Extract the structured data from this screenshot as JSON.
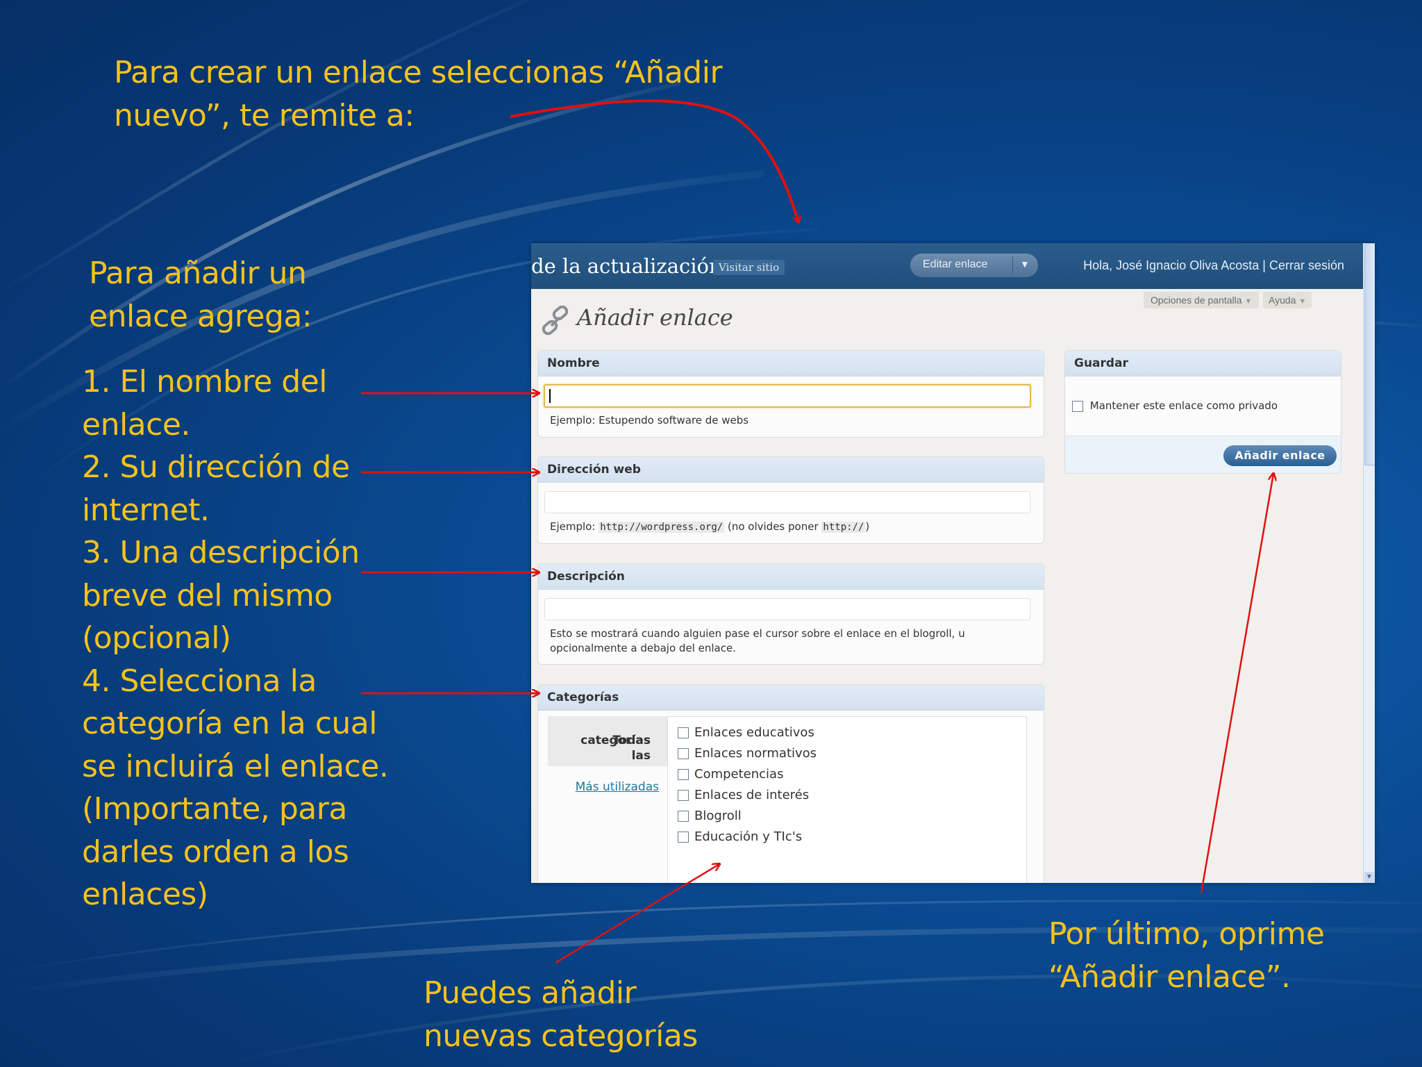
{
  "annotations": {
    "intro": [
      "Para crear un enlace seleccionas “Añadir",
      "nuevo”,  te remite a:"
    ],
    "add_heading": [
      "Para añadir un",
      "enlace agrega:"
    ],
    "steps": [
      "1. El nombre del",
      "enlace.",
      "2. Su dirección de",
      "internet.",
      "3. Una descripción",
      "breve del mismo",
      "(opcional)",
      "4. Selecciona la",
      "categoría en la cual",
      "se incluirá el enlace.",
      "(Importante, para",
      "darles orden a los",
      "enlaces)"
    ],
    "new_categories": [
      "Puedes añadir",
      "nuevas categorías"
    ],
    "finally": [
      "Por último, oprime",
      "“Añadir enlace”."
    ]
  },
  "colors": {
    "annotation_text": "#f6c21c",
    "arrow": "#e01010",
    "topbar": "#21527f",
    "accent_focus": "#e5b74a"
  },
  "screenshot": {
    "header": {
      "site_title": "de la actualización",
      "visit_label": "Visitar sitio",
      "edit_button": "Editar enlace",
      "dropdown_icon": "triangle-down",
      "greeting": "Hola, José Ignacio Oliva Acosta | Cerrar sesión"
    },
    "screen_options": "Opciones de pantalla",
    "help": "Ayuda",
    "page_title": "Añadir enlace",
    "page_icon": "link-chain",
    "name_box": {
      "title": "Nombre",
      "value": "",
      "hint": "Ejemplo: Estupendo software de webs"
    },
    "url_box": {
      "title": "Dirección web",
      "value": "",
      "hint_prefix": "Ejemplo:",
      "hint_code": "http://wordpress.org/",
      "hint_mid": "(no olvides poner",
      "hint_code2": "http://",
      "hint_suffix": ")"
    },
    "desc_box": {
      "title": "Descripción",
      "value": "",
      "hint": [
        "Esto se mostrará cuando alguien pase el cursor sobre el enlace en el blogroll, u",
        "opcionalmente a debajo del enlace."
      ]
    },
    "categories_box": {
      "title": "Categorías",
      "tab_all": [
        "Todas las",
        "categorías"
      ],
      "tab_used": "Más utilizadas",
      "items": [
        "Enlaces educativos",
        "Enlaces normativos",
        "Competencias",
        "Enlaces de interés",
        "Blogroll",
        "Educación y TIc's"
      ]
    },
    "save_box": {
      "title": "Guardar",
      "private_label": "Mantener este enlace como privado",
      "submit": "Añadir enlace"
    }
  }
}
